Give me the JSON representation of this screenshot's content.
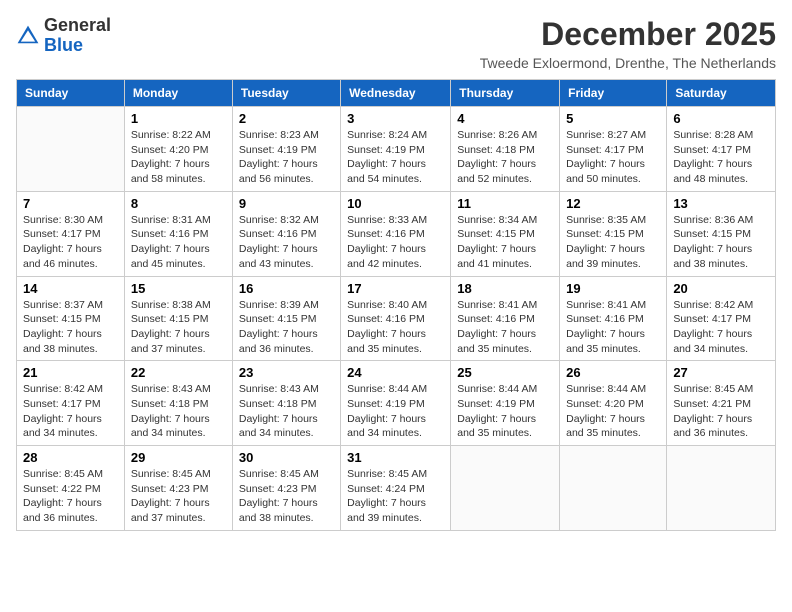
{
  "logo": {
    "general": "General",
    "blue": "Blue"
  },
  "title": "December 2025",
  "subtitle": "Tweede Exloermond, Drenthe, The Netherlands",
  "days_of_week": [
    "Sunday",
    "Monday",
    "Tuesday",
    "Wednesday",
    "Thursday",
    "Friday",
    "Saturday"
  ],
  "weeks": [
    [
      {
        "day": "",
        "info": ""
      },
      {
        "day": "1",
        "info": "Sunrise: 8:22 AM\nSunset: 4:20 PM\nDaylight: 7 hours\nand 58 minutes."
      },
      {
        "day": "2",
        "info": "Sunrise: 8:23 AM\nSunset: 4:19 PM\nDaylight: 7 hours\nand 56 minutes."
      },
      {
        "day": "3",
        "info": "Sunrise: 8:24 AM\nSunset: 4:19 PM\nDaylight: 7 hours\nand 54 minutes."
      },
      {
        "day": "4",
        "info": "Sunrise: 8:26 AM\nSunset: 4:18 PM\nDaylight: 7 hours\nand 52 minutes."
      },
      {
        "day": "5",
        "info": "Sunrise: 8:27 AM\nSunset: 4:17 PM\nDaylight: 7 hours\nand 50 minutes."
      },
      {
        "day": "6",
        "info": "Sunrise: 8:28 AM\nSunset: 4:17 PM\nDaylight: 7 hours\nand 48 minutes."
      }
    ],
    [
      {
        "day": "7",
        "info": "Sunrise: 8:30 AM\nSunset: 4:17 PM\nDaylight: 7 hours\nand 46 minutes."
      },
      {
        "day": "8",
        "info": "Sunrise: 8:31 AM\nSunset: 4:16 PM\nDaylight: 7 hours\nand 45 minutes."
      },
      {
        "day": "9",
        "info": "Sunrise: 8:32 AM\nSunset: 4:16 PM\nDaylight: 7 hours\nand 43 minutes."
      },
      {
        "day": "10",
        "info": "Sunrise: 8:33 AM\nSunset: 4:16 PM\nDaylight: 7 hours\nand 42 minutes."
      },
      {
        "day": "11",
        "info": "Sunrise: 8:34 AM\nSunset: 4:15 PM\nDaylight: 7 hours\nand 41 minutes."
      },
      {
        "day": "12",
        "info": "Sunrise: 8:35 AM\nSunset: 4:15 PM\nDaylight: 7 hours\nand 39 minutes."
      },
      {
        "day": "13",
        "info": "Sunrise: 8:36 AM\nSunset: 4:15 PM\nDaylight: 7 hours\nand 38 minutes."
      }
    ],
    [
      {
        "day": "14",
        "info": "Sunrise: 8:37 AM\nSunset: 4:15 PM\nDaylight: 7 hours\nand 38 minutes."
      },
      {
        "day": "15",
        "info": "Sunrise: 8:38 AM\nSunset: 4:15 PM\nDaylight: 7 hours\nand 37 minutes."
      },
      {
        "day": "16",
        "info": "Sunrise: 8:39 AM\nSunset: 4:15 PM\nDaylight: 7 hours\nand 36 minutes."
      },
      {
        "day": "17",
        "info": "Sunrise: 8:40 AM\nSunset: 4:16 PM\nDaylight: 7 hours\nand 35 minutes."
      },
      {
        "day": "18",
        "info": "Sunrise: 8:41 AM\nSunset: 4:16 PM\nDaylight: 7 hours\nand 35 minutes."
      },
      {
        "day": "19",
        "info": "Sunrise: 8:41 AM\nSunset: 4:16 PM\nDaylight: 7 hours\nand 35 minutes."
      },
      {
        "day": "20",
        "info": "Sunrise: 8:42 AM\nSunset: 4:17 PM\nDaylight: 7 hours\nand 34 minutes."
      }
    ],
    [
      {
        "day": "21",
        "info": "Sunrise: 8:42 AM\nSunset: 4:17 PM\nDaylight: 7 hours\nand 34 minutes."
      },
      {
        "day": "22",
        "info": "Sunrise: 8:43 AM\nSunset: 4:18 PM\nDaylight: 7 hours\nand 34 minutes."
      },
      {
        "day": "23",
        "info": "Sunrise: 8:43 AM\nSunset: 4:18 PM\nDaylight: 7 hours\nand 34 minutes."
      },
      {
        "day": "24",
        "info": "Sunrise: 8:44 AM\nSunset: 4:19 PM\nDaylight: 7 hours\nand 34 minutes."
      },
      {
        "day": "25",
        "info": "Sunrise: 8:44 AM\nSunset: 4:19 PM\nDaylight: 7 hours\nand 35 minutes."
      },
      {
        "day": "26",
        "info": "Sunrise: 8:44 AM\nSunset: 4:20 PM\nDaylight: 7 hours\nand 35 minutes."
      },
      {
        "day": "27",
        "info": "Sunrise: 8:45 AM\nSunset: 4:21 PM\nDaylight: 7 hours\nand 36 minutes."
      }
    ],
    [
      {
        "day": "28",
        "info": "Sunrise: 8:45 AM\nSunset: 4:22 PM\nDaylight: 7 hours\nand 36 minutes."
      },
      {
        "day": "29",
        "info": "Sunrise: 8:45 AM\nSunset: 4:23 PM\nDaylight: 7 hours\nand 37 minutes."
      },
      {
        "day": "30",
        "info": "Sunrise: 8:45 AM\nSunset: 4:23 PM\nDaylight: 7 hours\nand 38 minutes."
      },
      {
        "day": "31",
        "info": "Sunrise: 8:45 AM\nSunset: 4:24 PM\nDaylight: 7 hours\nand 39 minutes."
      },
      {
        "day": "",
        "info": ""
      },
      {
        "day": "",
        "info": ""
      },
      {
        "day": "",
        "info": ""
      }
    ]
  ]
}
